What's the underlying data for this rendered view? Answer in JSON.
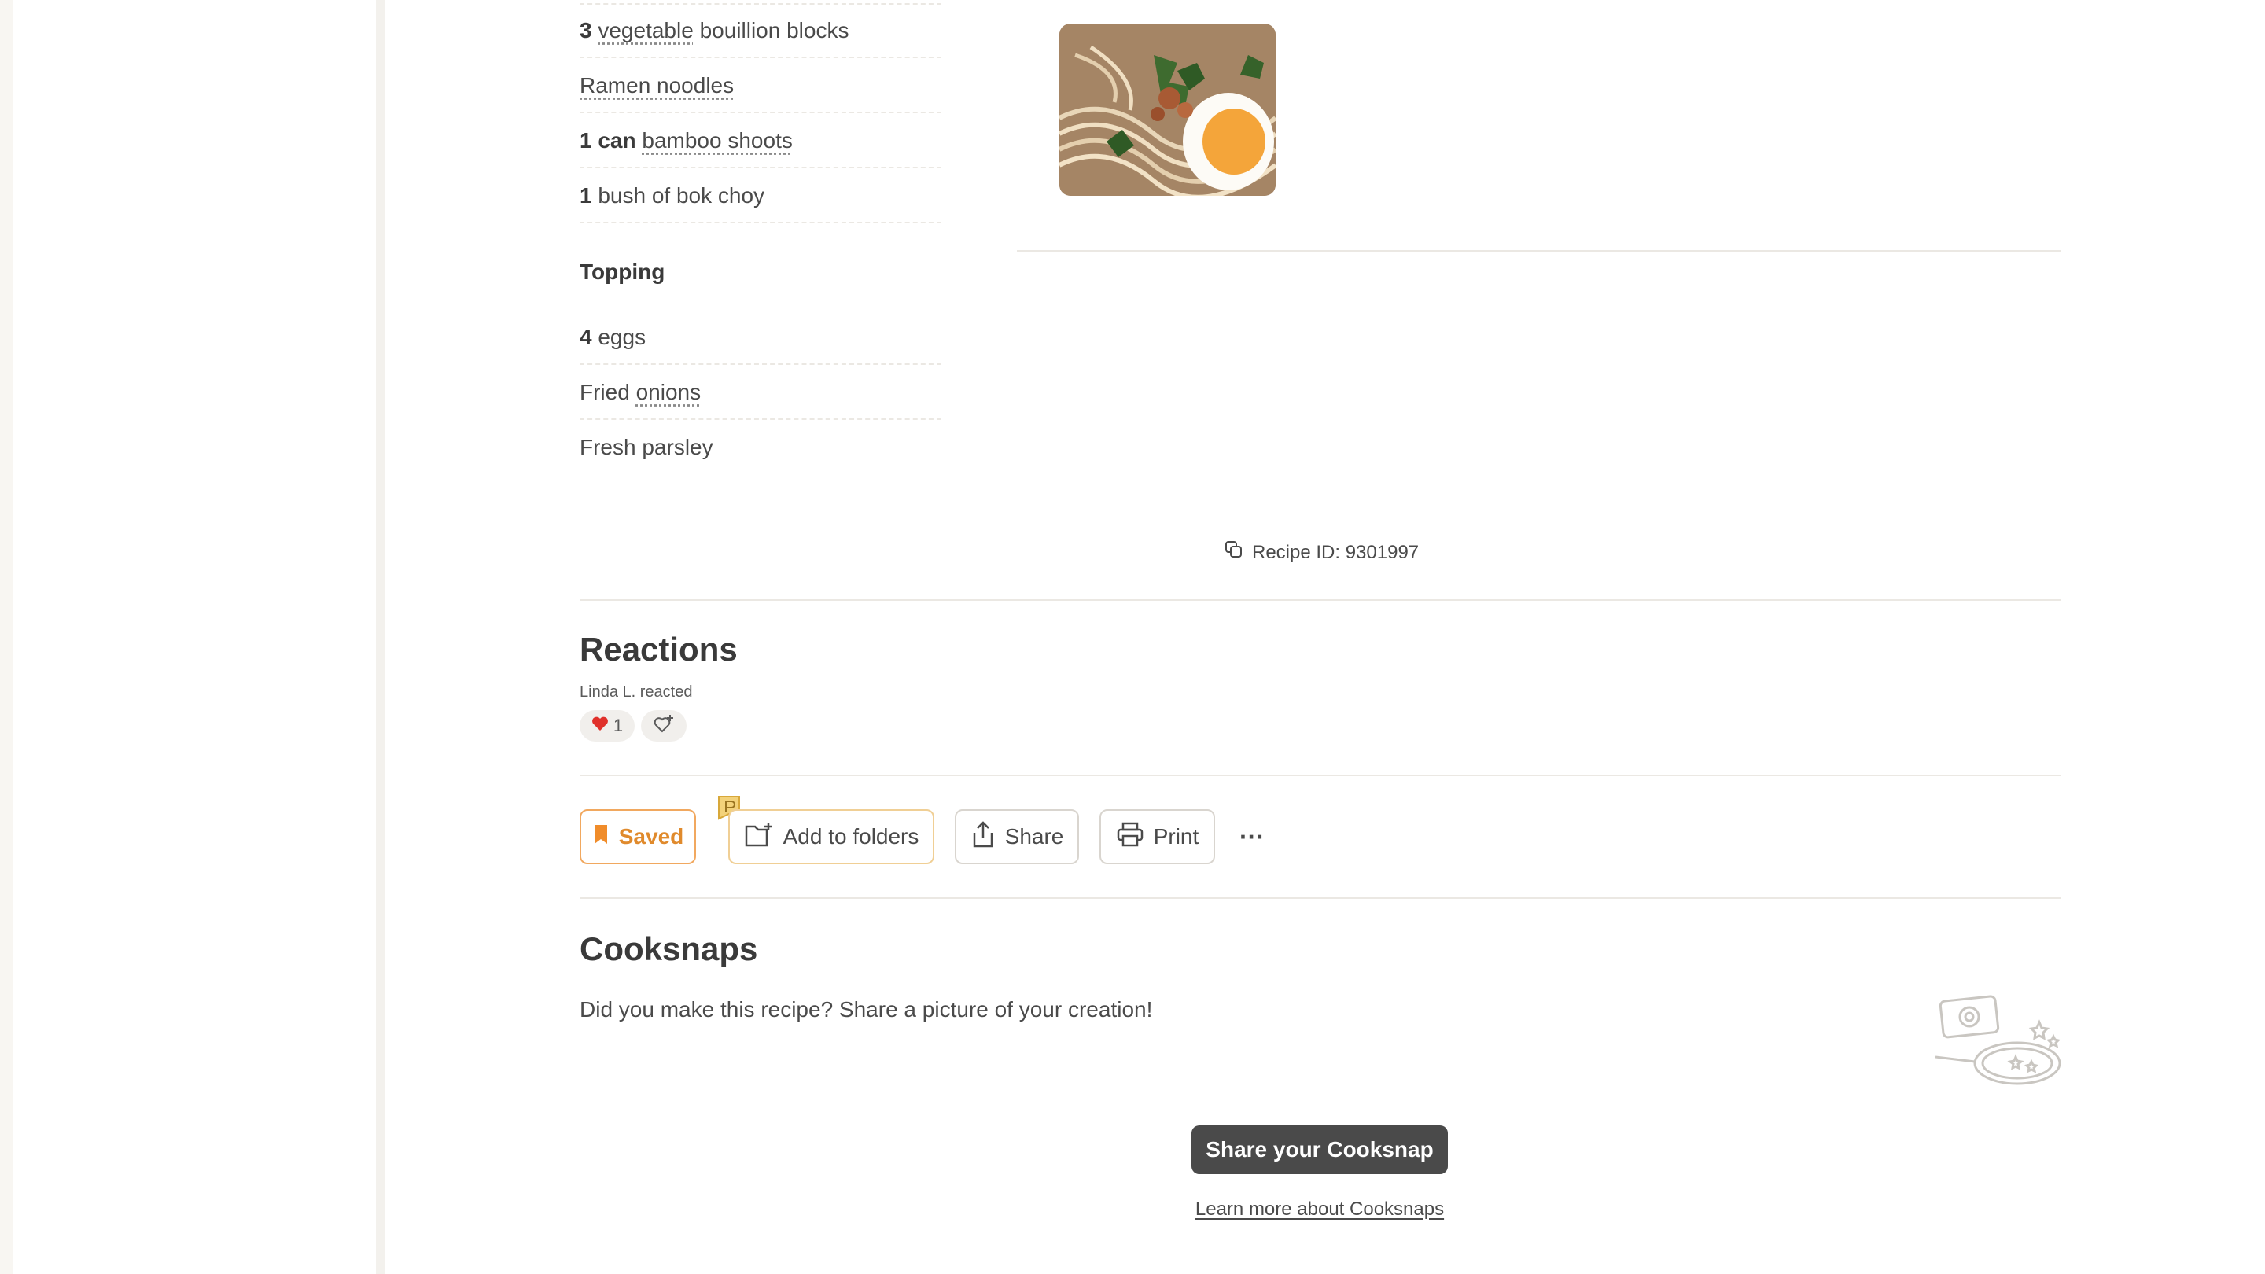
{
  "ingredients_main": [
    {
      "qty": "3",
      "name_link": "vegetable",
      "name_rest": " bouillion blocks"
    },
    {
      "qty": "",
      "name_link": "Ramen noodles",
      "name_rest": ""
    },
    {
      "qty": "1 can",
      "name_link": "bamboo shoots",
      "name_rest": ""
    },
    {
      "qty": "1",
      "name_link": "",
      "name_rest": "bush of bok choy"
    }
  ],
  "topping": {
    "heading": "Topping",
    "items": [
      {
        "qty": "4",
        "name_pre": "eggs",
        "name_link": ""
      },
      {
        "qty": "",
        "name_pre": "Fried ",
        "name_link": "onions"
      },
      {
        "qty": "",
        "name_pre": "Fresh parsley",
        "name_link": ""
      }
    ]
  },
  "recipe_id": {
    "label": "Recipe ID: 9301997"
  },
  "reactions": {
    "title": "Reactions",
    "reacted_text": "Linda L. reacted",
    "heart_count": "1"
  },
  "actions": {
    "saved": "Saved",
    "add_to_folders": "Add to folders",
    "share": "Share",
    "print": "Print",
    "more": "···"
  },
  "cooksnaps": {
    "title": "Cooksnaps",
    "prompt": "Did you make this recipe? Share a picture of your creation!",
    "button": "Share your Cooksnap",
    "learn_more": "Learn more about Cooksnaps"
  },
  "colors": {
    "accent_orange": "#e08a2c",
    "button_dark": "#4a4a4a",
    "divider": "#ebe8e3"
  }
}
